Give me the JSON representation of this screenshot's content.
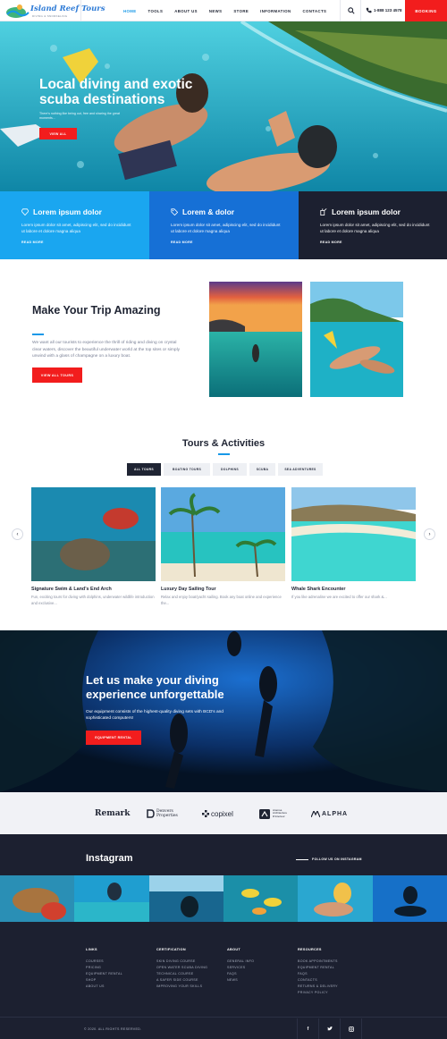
{
  "header": {
    "logo_text": "Island Reef Tours",
    "logo_sub": "DIVING & SNORKELING",
    "nav": [
      "HOME",
      "TOOLS",
      "ABOUT US",
      "NEWS",
      "STORE",
      "INFORMATION",
      "CONTACTS"
    ],
    "active_nav": "HOME",
    "phone": "1-888 123 4578",
    "booking_label": "BOOKING",
    "icons": [
      "search-icon",
      "phone-icon"
    ]
  },
  "hero": {
    "title": "Local diving and exotic scuba destinations",
    "subtitle": "There's nothing like being out, free and sharing the great moments...",
    "button": "VIEW ALL"
  },
  "features": [
    {
      "title": "Lorem ipsum dolor",
      "text": "Lorem ipsum dolor sit amet, adipiscing elit, sed do incididunt ut labore et dolore magna aliqua",
      "more": "READ MORE",
      "color": "#1aa6f0",
      "icon": "diamond-icon"
    },
    {
      "title": "Lorem & dolor",
      "text": "Lorem ipsum dolor sit amet, adipiscing elit, sed do incididunt ut labore et dolore magna aliqua",
      "more": "READ MORE",
      "color": "#1670d6",
      "icon": "tag-icon"
    },
    {
      "title": "Lorem ipsum dolor",
      "text": "Lorem ipsum dolor sit amet, adipiscing elit, sed do incididunt ut labore et dolore magna aliqua",
      "more": "READ MORE",
      "color": "#1c2030",
      "icon": "tools-icon"
    }
  ],
  "trip": {
    "title": "Make Your Trip Amazing",
    "description": "We want all our tourists to experience the thrill of riding and diving on crystal clear waters, discover the beautiful underwater world at the top sites or simply unwind with a glass of champagne on a luxury boat.",
    "button": "VIEW ALL TOURS"
  },
  "tours": {
    "title": "Tours & Activities",
    "tabs": [
      "ALL TOURS",
      "BOATING TOURS",
      "DOLPHINS",
      "SCUBA",
      "SEA ADVENTURES"
    ],
    "active_tab": "ALL TOURS",
    "cards": [
      {
        "name": "Signature Swim & Land's End Arch",
        "desc": "Fun, exciting tours for diving with dolphins, underwater wildlife introduction and exclusive..."
      },
      {
        "name": "Luxury Day Sailing Tour",
        "desc": "Relax and enjoy boat/yacht sailing. Book any boat online and experience the..."
      },
      {
        "name": "Whale Shark Encounter",
        "desc": "If you like adrenaline we are excited to offer our shark &..."
      }
    ],
    "prev": "‹",
    "next": "›"
  },
  "dive": {
    "title": "Let us make your diving experience unforgettable",
    "desc": "Our equipment consists of the highest-quality diving sets with BCD's and sophisticated computers!",
    "button": "EQUIPMENT RENTAL"
  },
  "partners": [
    {
      "name": "Remark"
    },
    {
      "name": "Denvers Properties",
      "line1": "Denvers",
      "line2": "Properties"
    },
    {
      "name": "copixel"
    },
    {
      "name": "Aramsa Architecture D'interieur",
      "line1": "Aramsa",
      "line2": "Architecture",
      "line3": "D'interieur"
    },
    {
      "name": "ALPHA"
    }
  ],
  "instagram": {
    "title": "Instagram",
    "follow": "FOLLOW US ON INSTAGRAM"
  },
  "footer": {
    "columns": [
      {
        "heading": "LINKS",
        "items": [
          "COURSES",
          "PRICING",
          "EQUIPMENT RENTAL",
          "SHOP",
          "ABOUT US"
        ]
      },
      {
        "heading": "CERTIFICATION",
        "items": [
          "SKIN DIVING COURSE",
          "OPEN WATER SCUBA DIVING",
          "TECHNICAL COURSE",
          "A SAFER SIDE COURSE",
          "IMPROVING YOUR SKILLS"
        ]
      },
      {
        "heading": "ABOUT",
        "items": [
          "GENERAL INFO",
          "SERVICES",
          "FAQS",
          "NEWS"
        ]
      },
      {
        "heading": "RESOURCES",
        "items": [
          "BOOK APPOINTMENTS",
          "EQUIPMENT RENTAL",
          "FAQS",
          "CONTACTS",
          "RETURNS & DELIVERY",
          "PRIVACY POLICY"
        ]
      }
    ],
    "copyright": "© 2020. ALL RIGHTS RESERVED.",
    "social": [
      "f",
      "twitter",
      "ig"
    ],
    "social_icons": [
      "facebook-icon",
      "twitter-icon",
      "instagram-icon"
    ]
  },
  "colors": {
    "accent": "#f21d1d",
    "blue": "#1798e8",
    "dark": "#1c2030"
  }
}
